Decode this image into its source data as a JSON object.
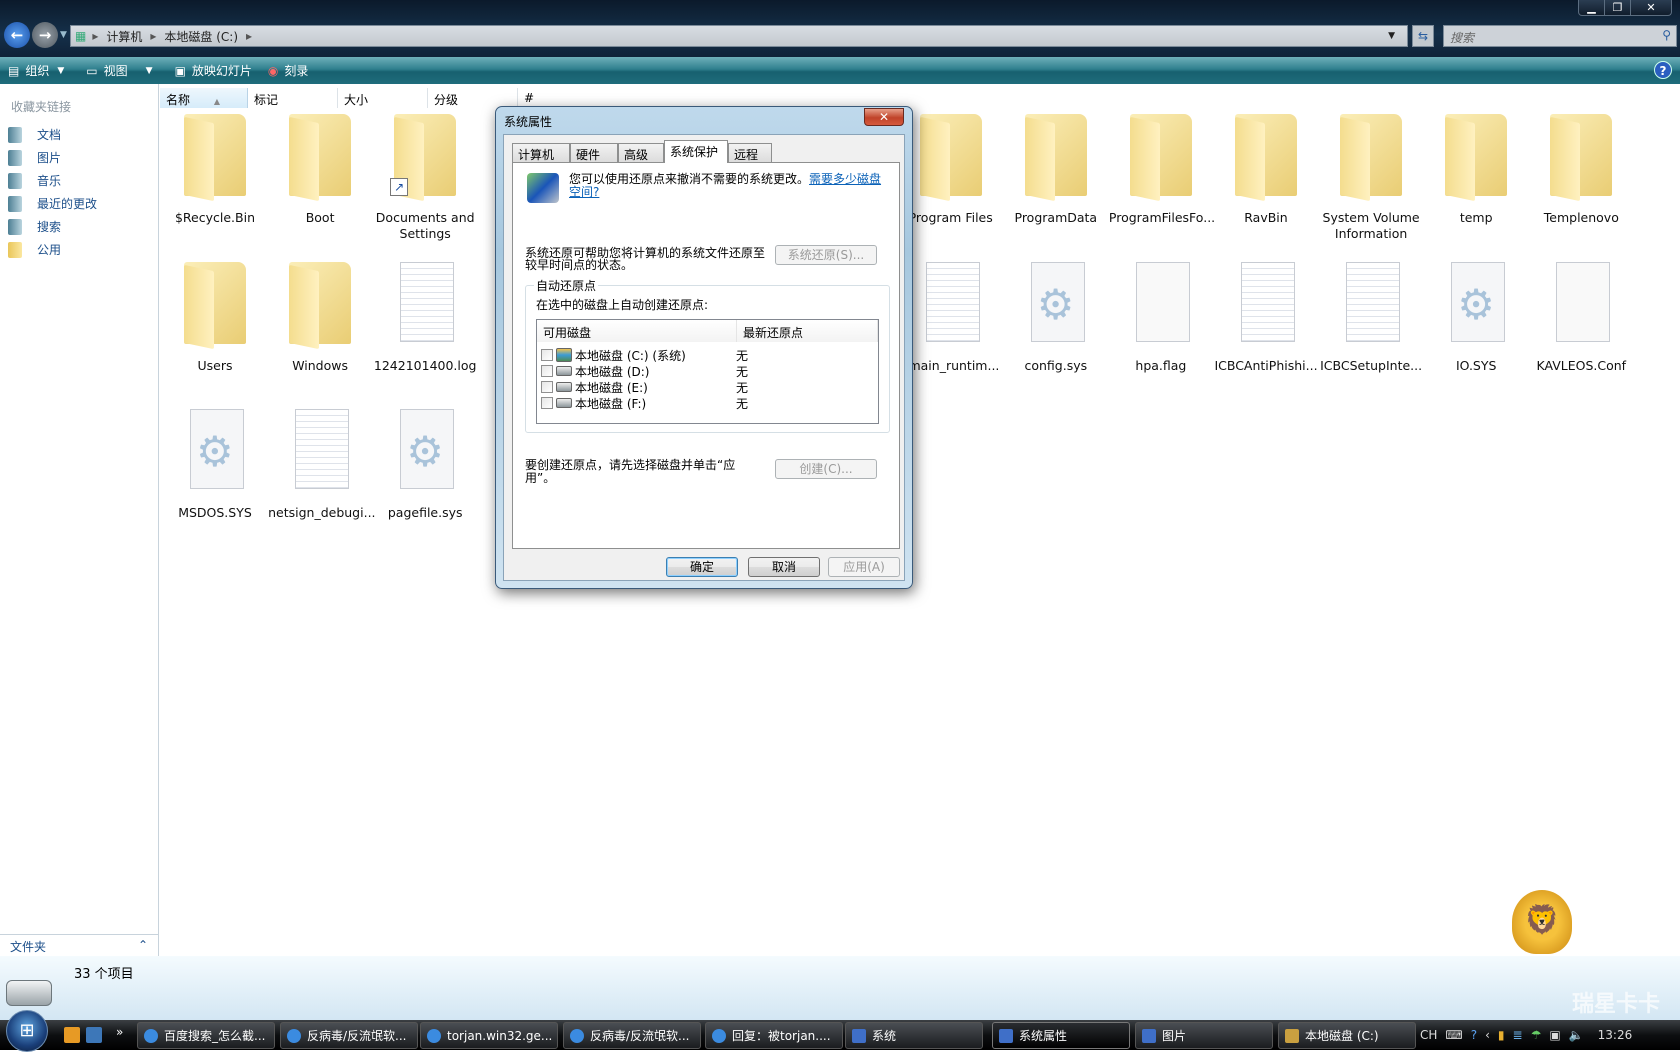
{
  "window": {
    "controls": [
      "minimize",
      "restore",
      "close"
    ]
  },
  "address": {
    "breadcrumb": [
      "计算机",
      "本地磁盘 (C:)"
    ],
    "search_placeholder": "搜索"
  },
  "toolbar": {
    "organize": "组织",
    "views": "视图",
    "slideshow": "放映幻灯片",
    "burn": "刻录"
  },
  "nav": {
    "heading": "收藏夹链接",
    "items": [
      {
        "label": "文档",
        "icon": "documents-icon"
      },
      {
        "label": "图片",
        "icon": "pictures-icon"
      },
      {
        "label": "音乐",
        "icon": "music-icon"
      },
      {
        "label": "最近的更改",
        "icon": "recent-icon"
      },
      {
        "label": "搜索",
        "icon": "search-icon"
      },
      {
        "label": "公用",
        "icon": "public-folder-icon"
      }
    ],
    "folders_label": "文件夹"
  },
  "columns": [
    "名称",
    "标记",
    "大小",
    "分级",
    "#"
  ],
  "files": [
    {
      "name": "$Recycle.Bin",
      "type": "folder"
    },
    {
      "name": "Boot",
      "type": "folder"
    },
    {
      "name": "Documents and Settings",
      "type": "folder-shortcut"
    },
    null,
    null,
    null,
    null,
    {
      "name": "Program Files",
      "type": "folder"
    },
    {
      "name": "ProgramData",
      "type": "folder"
    },
    {
      "name": "ProgramFilesFo...",
      "type": "folder"
    },
    {
      "name": "RavBin",
      "type": "folder"
    },
    {
      "name": "System Volume Information",
      "type": "folder"
    },
    {
      "name": "temp",
      "type": "folder"
    },
    {
      "name": "Templenovo",
      "type": "folder"
    },
    {
      "name": "Users",
      "type": "folder"
    },
    {
      "name": "Windows",
      "type": "folder"
    },
    {
      "name": "1242101400.log",
      "type": "text"
    },
    null,
    null,
    null,
    null,
    {
      "name": "smain_runtim...",
      "type": "text"
    },
    {
      "name": "config.sys",
      "type": "system"
    },
    {
      "name": "hpa.flag",
      "type": "blank"
    },
    {
      "name": "ICBCAntiPhishi...",
      "type": "text"
    },
    {
      "name": "ICBCSetupInte...",
      "type": "text"
    },
    {
      "name": "IO.SYS",
      "type": "system"
    },
    {
      "name": "KAVLEOS.Conf",
      "type": "blank"
    },
    {
      "name": "MSDOS.SYS",
      "type": "system"
    },
    {
      "name": "netsign_debugi...",
      "type": "text"
    },
    {
      "name": "pagefile.sys",
      "type": "system"
    },
    null,
    null
  ],
  "status": {
    "item_count": "33 个项目"
  },
  "dialog": {
    "title": "系统属性",
    "tabs": [
      "计算机名",
      "硬件",
      "高级",
      "系统保护",
      "远程"
    ],
    "active_tab": "系统保护",
    "intro": "您可以使用还原点来撤消不需要的系统更改。",
    "intro_link": "需要多少磁盘空间?",
    "restore_text": "系统还原可帮助您将计算机的系统文件还原至较早时间点的状态。",
    "restore_button": "系统还原(S)...",
    "group_label": "自动还原点",
    "group_desc": "在选中的磁盘上自动创建还原点:",
    "list_headers": [
      "可用磁盘",
      "最新还原点"
    ],
    "disks": [
      {
        "name": "本地磁盘 (C:) (系统)",
        "latest": "无",
        "checked": false,
        "system": true
      },
      {
        "name": "本地磁盘 (D:)",
        "latest": "无",
        "checked": false,
        "system": false
      },
      {
        "name": "本地磁盘 (E:)",
        "latest": "无",
        "checked": false,
        "system": false
      },
      {
        "name": "本地磁盘 (F:)",
        "latest": "无",
        "checked": false,
        "system": false
      }
    ],
    "create_text": "要创建还原点，请先选择磁盘并单击“应用”。",
    "create_button": "创建(C)...",
    "ok": "确定",
    "cancel": "取消",
    "apply": "应用(A)"
  },
  "taskbar": {
    "tasks": [
      {
        "label": "百度搜索_怎么截...",
        "icon": "ie-icon"
      },
      {
        "label": "反病毒/反流氓软...",
        "icon": "ie-icon"
      },
      {
        "label": "torjan.win32.ge...",
        "icon": "ie-icon"
      },
      {
        "label": "反病毒/反流氓软...",
        "icon": "ie-icon"
      },
      {
        "label": "回复：被torjan....",
        "icon": "ie-icon"
      },
      {
        "label": "系统",
        "icon": "system-icon"
      },
      {
        "label": "系统属性",
        "icon": "system-icon",
        "active": true
      },
      {
        "label": "图片",
        "icon": "pictures-icon"
      },
      {
        "label": "本地磁盘 (C:)",
        "icon": "drive-icon"
      }
    ],
    "lang": "CH",
    "clock": "13:26"
  },
  "watermark": "瑞星卡卡 www.ikaka.com"
}
